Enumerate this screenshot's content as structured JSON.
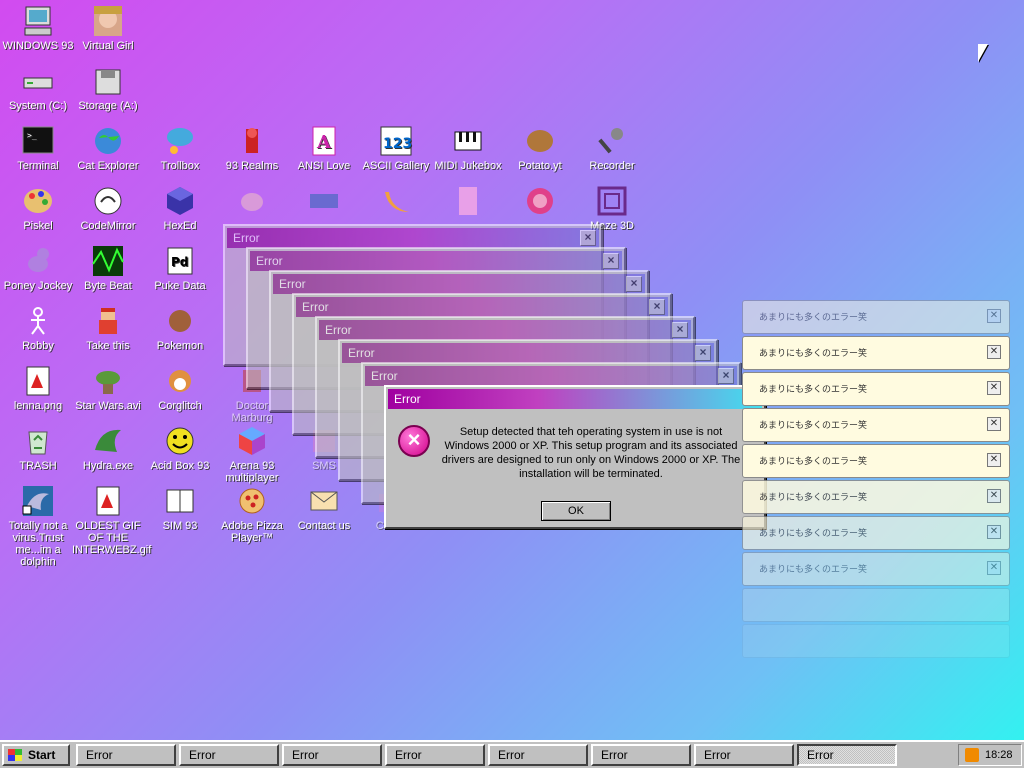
{
  "colors": {
    "desktop_start": "#d24bf0",
    "desktop_end": "#2ef5f0",
    "titlebar": "#7a007a",
    "notif_bg": "#fffbe0"
  },
  "desktop": {
    "icons": [
      {
        "id": "windows93",
        "label": "WINDOWS 93",
        "icon": "computer-icon"
      },
      {
        "id": "virtualgirl",
        "label": "Virtual Girl",
        "icon": "face-icon"
      },
      {
        "id": "systemc",
        "label": "System (C:)",
        "icon": "drive-icon"
      },
      {
        "id": "storagea",
        "label": "Storage (A:)",
        "icon": "floppy-icon"
      },
      {
        "id": "terminal",
        "label": "Terminal",
        "icon": "terminal-icon"
      },
      {
        "id": "catexplorer",
        "label": "Cat Explorer",
        "icon": "globe-cat-icon"
      },
      {
        "id": "trollbox",
        "label": "Trollbox",
        "icon": "chat-bubble-icon"
      },
      {
        "id": "realms",
        "label": "93 Realms",
        "icon": "knight-icon"
      },
      {
        "id": "ansilove",
        "label": "ANSI Love",
        "icon": "letter-a-icon"
      },
      {
        "id": "asciigallery",
        "label": "ASCII Gallery",
        "icon": "numbers-icon"
      },
      {
        "id": "midijukebox",
        "label": "MIDI Jukebox",
        "icon": "piano-icon"
      },
      {
        "id": "potato",
        "label": "Potato.yt",
        "icon": "potato-icon"
      },
      {
        "id": "recorder",
        "label": "Recorder",
        "icon": "microphone-icon"
      },
      {
        "id": "piskel",
        "label": "Piskel",
        "icon": "palette-icon"
      },
      {
        "id": "codemirror",
        "label": "CodeMirror",
        "icon": "mirror-icon"
      },
      {
        "id": "hexed",
        "label": "HexEd",
        "icon": "cube-icon"
      },
      {
        "id": "maze3d",
        "label": "Maze 3D",
        "icon": "maze-icon"
      },
      {
        "id": "poney",
        "label": "Poney Jockey",
        "icon": "pony-icon"
      },
      {
        "id": "bytebeat",
        "label": "Byte Beat",
        "icon": "wave-icon"
      },
      {
        "id": "pukedata",
        "label": "Puke Data",
        "icon": "pd-icon"
      },
      {
        "id": "robby",
        "label": "Robby",
        "icon": "stick-figure-icon"
      },
      {
        "id": "takethis",
        "label": "Take this",
        "icon": "pixel-man-icon"
      },
      {
        "id": "pokemon",
        "label": "Pokemon",
        "icon": "pokeball-icon"
      },
      {
        "id": "lenna",
        "label": "lenna.png",
        "icon": "image-file-icon"
      },
      {
        "id": "starwars",
        "label": "Star Wars.avi",
        "icon": "yoda-icon"
      },
      {
        "id": "corglitch",
        "label": "Corglitch",
        "icon": "corgi-icon"
      },
      {
        "id": "doctor",
        "label": "Doctor Marburg",
        "icon": "doctor-icon"
      },
      {
        "id": "trash",
        "label": "TRASH",
        "icon": "recycle-bin-icon"
      },
      {
        "id": "hydra",
        "label": "Hydra.exe",
        "icon": "dragon-icon"
      },
      {
        "id": "acidbox",
        "label": "Acid Box 93",
        "icon": "smiley-icon"
      },
      {
        "id": "arena",
        "label": "Arena 93 multiplayer",
        "icon": "cube-color-icon"
      },
      {
        "id": "sms",
        "label": "SMS",
        "icon": "sms-icon"
      },
      {
        "id": "dolphin",
        "label": "Totally not a virus.Trust me...im a dolphin",
        "icon": "dolphin-icon"
      },
      {
        "id": "oldestgif",
        "label": "OLDEST GIF OF THE INTERWEBZ.gif",
        "icon": "gif-file-icon"
      },
      {
        "id": "sim93",
        "label": "SIM 93",
        "icon": "book-icon"
      },
      {
        "id": "pizza",
        "label": "Adobe Pizza Player™",
        "icon": "pizza-icon"
      },
      {
        "id": "contact",
        "label": "Contact us",
        "icon": "envelope-icon"
      },
      {
        "id": "crazy",
        "label": "Craz...",
        "icon": "folder-icon"
      }
    ]
  },
  "error_dialog": {
    "title": "Error",
    "message": "Setup detected that teh operating system in use is not Windows 2000 or XP. This setup program and its associated drivers are designed to run only on Windows 2000 or XP. The installation will be terminated.",
    "ok_label": "OK",
    "ghost_titles": [
      "Error",
      "Error",
      "Error",
      "Error",
      "Error",
      "Error",
      "Error"
    ]
  },
  "notifications": {
    "text": "あまりにも多くのエラー笑",
    "close_glyph": "✕",
    "count_visible": 8
  },
  "taskbar": {
    "start_label": "Start",
    "tasks": [
      "Error",
      "Error",
      "Error",
      "Error",
      "Error",
      "Error",
      "Error",
      "Error"
    ],
    "active_index": 7,
    "clock": "18:28"
  }
}
